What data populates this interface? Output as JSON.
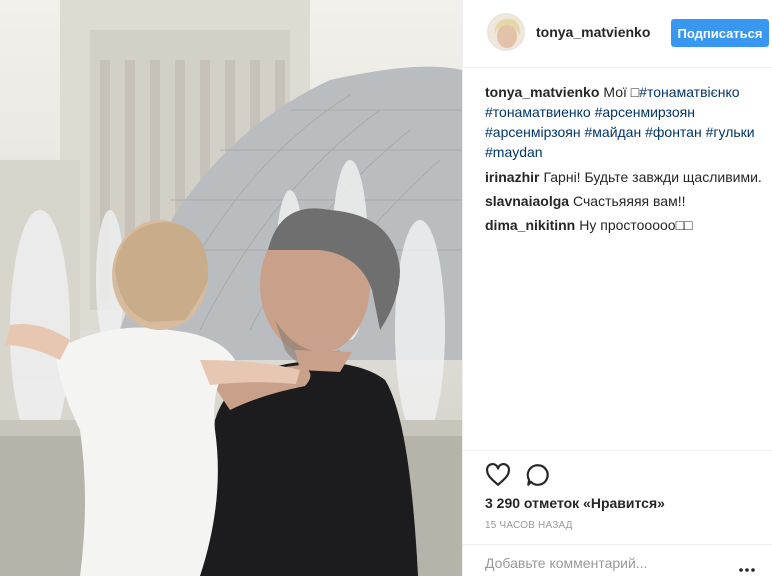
{
  "post": {
    "author": "tonya_matvienko",
    "follow_label": "Подписаться",
    "photo_alt": "Фото",
    "caption": {
      "user": "tonya_matvienko",
      "text": "Мої ",
      "emoji": "□",
      "tags": [
        "#тонаматвієнко",
        "#тонаматвиенко",
        "#арсенмирзоян",
        "#арсенмірзоян",
        "#майдан",
        "#фонтан",
        "#гульки",
        "#maydan"
      ]
    },
    "comments": [
      {
        "user": "irinazhir",
        "text": "Гарні! Будьте завжди щасливими."
      },
      {
        "user": "slavnaiaolga",
        "text": "Счастьяяяя вам!!"
      },
      {
        "user": "dima_nikitinn",
        "text": "Ну простооооо□□"
      }
    ],
    "likes": "3 290 отметок «Нравится»",
    "timestamp": "15 ЧАСОВ НАЗАД",
    "add_comment_placeholder": "Добавьте комментарий...",
    "icons": {
      "like": "heart-icon",
      "comment": "comment-icon",
      "more": "more-options-icon"
    },
    "colors": {
      "follow_button": "#3897f0",
      "hashtag": "#003569",
      "muted": "#999999"
    }
  }
}
